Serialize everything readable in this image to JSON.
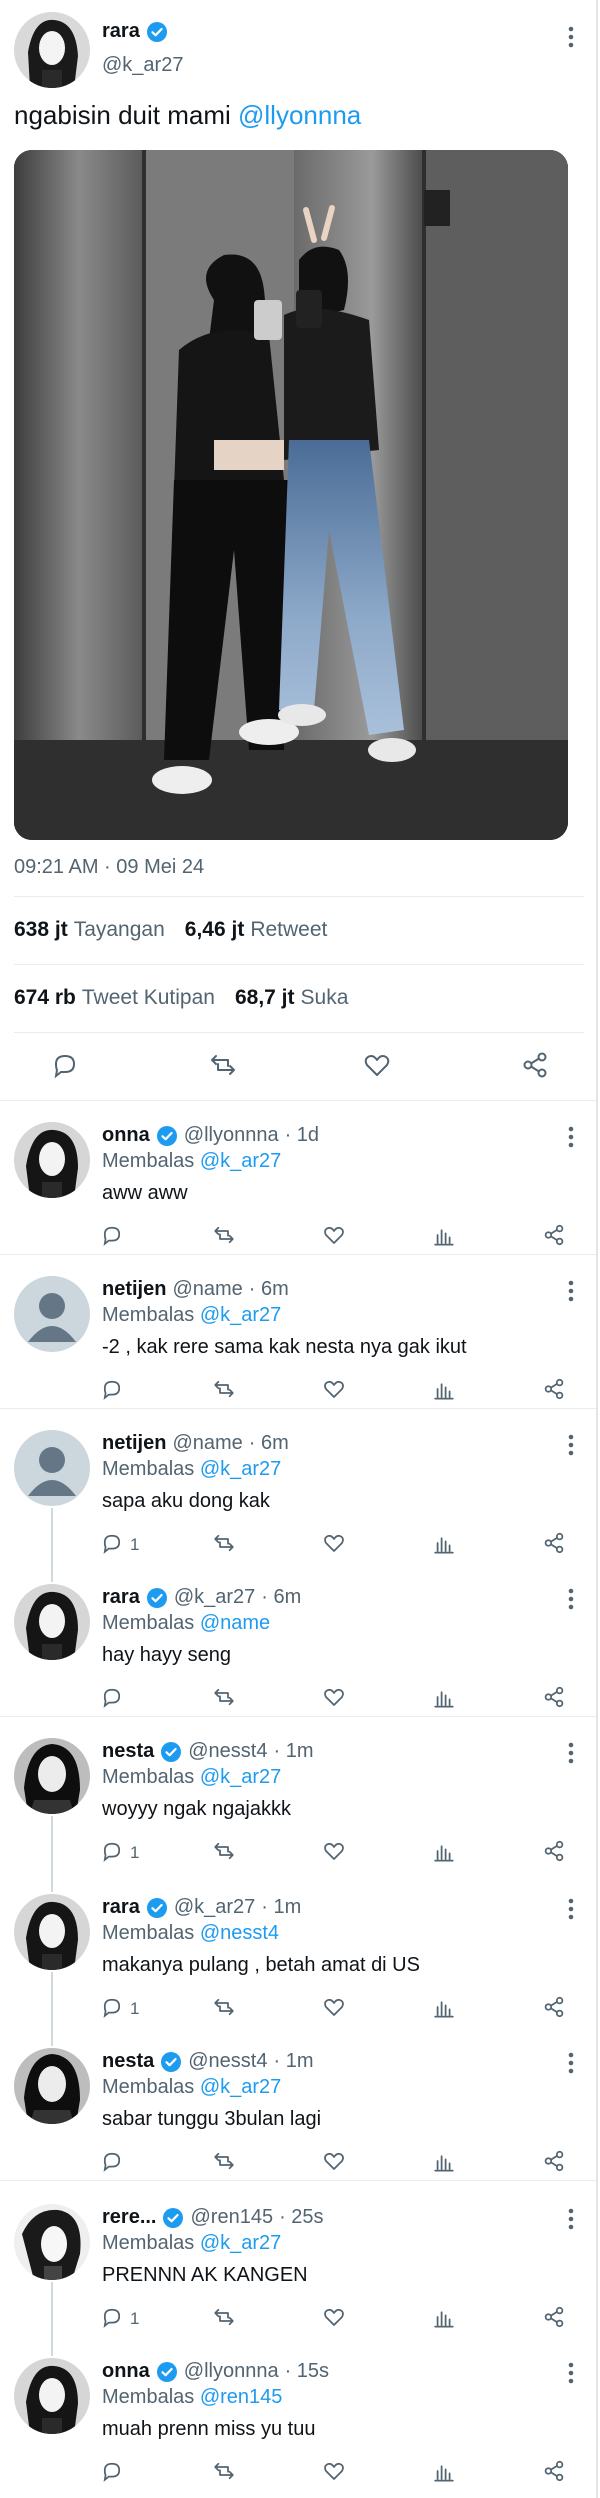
{
  "main_tweet": {
    "name": "rara",
    "handle": "@k_ar27",
    "text": "ngabisin duit mami ",
    "mention": "@llyonnna",
    "timestamp": "09:21 AM · 09 Mei 24",
    "stats": {
      "views_value": "638 jt",
      "views_label": "Tayangan",
      "retweets_value": "6,46 jt",
      "retweets_label": "Retweet",
      "quotes_value": "674 rb",
      "quotes_label": "Tweet Kutipan",
      "likes_value": "68,7 jt",
      "likes_label": "Suka"
    }
  },
  "replies": [
    {
      "name": "onna",
      "handle": "@llyonnna",
      "time": "· 1d",
      "replying_label": "Membalas",
      "replying_to": "@k_ar27",
      "text": "aww aww",
      "reply_count": "",
      "verified": true,
      "avatar": "bw"
    },
    {
      "name": "netijen",
      "handle": "@name",
      "time": "· 6m",
      "replying_label": "Membalas",
      "replying_to": "@k_ar27",
      "text": "-2 , kak rere sama kak nesta nya gak ikut",
      "reply_count": "",
      "verified": false,
      "avatar": "default"
    },
    {
      "name": "netijen",
      "handle": "@name",
      "time": "· 6m",
      "replying_label": "Membalas",
      "replying_to": "@k_ar27",
      "text": "sapa aku dong kak",
      "reply_count": "1",
      "verified": false,
      "avatar": "default"
    },
    {
      "name": "rara",
      "handle": "@k_ar27",
      "time": "· 6m",
      "replying_label": "Membalas",
      "replying_to": "@name",
      "text": "hay hayy seng",
      "reply_count": "",
      "verified": true,
      "avatar": "bw"
    },
    {
      "name": "nesta",
      "handle": "@nesst4",
      "time": "· 1m",
      "replying_label": "Membalas",
      "replying_to": "@k_ar27",
      "text": "woyyy ngak ngajakkk",
      "reply_count": "1",
      "verified": true,
      "avatar": "bw2"
    },
    {
      "name": "rara",
      "handle": "@k_ar27",
      "time": "· 1m",
      "replying_label": "Membalas",
      "replying_to": "@nesst4",
      "text": "makanya pulang , betah amat di US",
      "reply_count": "1",
      "verified": true,
      "avatar": "bw"
    },
    {
      "name": "nesta",
      "handle": "@nesst4",
      "time": "· 1m",
      "replying_label": "Membalas",
      "replying_to": "@k_ar27",
      "text": "sabar tunggu 3bulan lagi",
      "reply_count": "",
      "verified": true,
      "avatar": "bw2"
    },
    {
      "name": "rere...",
      "handle": "@ren145",
      "time": "· 25s",
      "replying_label": "Membalas",
      "replying_to": "@k_ar27",
      "text": "PRENNN AK KANGEN",
      "reply_count": "1",
      "verified": true,
      "avatar": "bw3"
    },
    {
      "name": "onna",
      "handle": "@llyonnna",
      "time": "· 15s",
      "replying_label": "Membalas",
      "replying_to": "@ren145",
      "text": "muah prenn miss yu tuu",
      "reply_count": "",
      "verified": true,
      "avatar": "bw"
    }
  ],
  "icons": {
    "reply": "speech-bubble-icon",
    "retweet": "retweet-icon",
    "like": "heart-icon",
    "views": "bar-chart-icon",
    "share": "share-icon",
    "more": "vertical-dots-icon",
    "verified": "verified-badge-icon"
  },
  "colors": {
    "accent": "#1d9bf0",
    "secondary_text": "#536471",
    "primary_text": "#0f1419",
    "divider": "#e6ecf0"
  }
}
